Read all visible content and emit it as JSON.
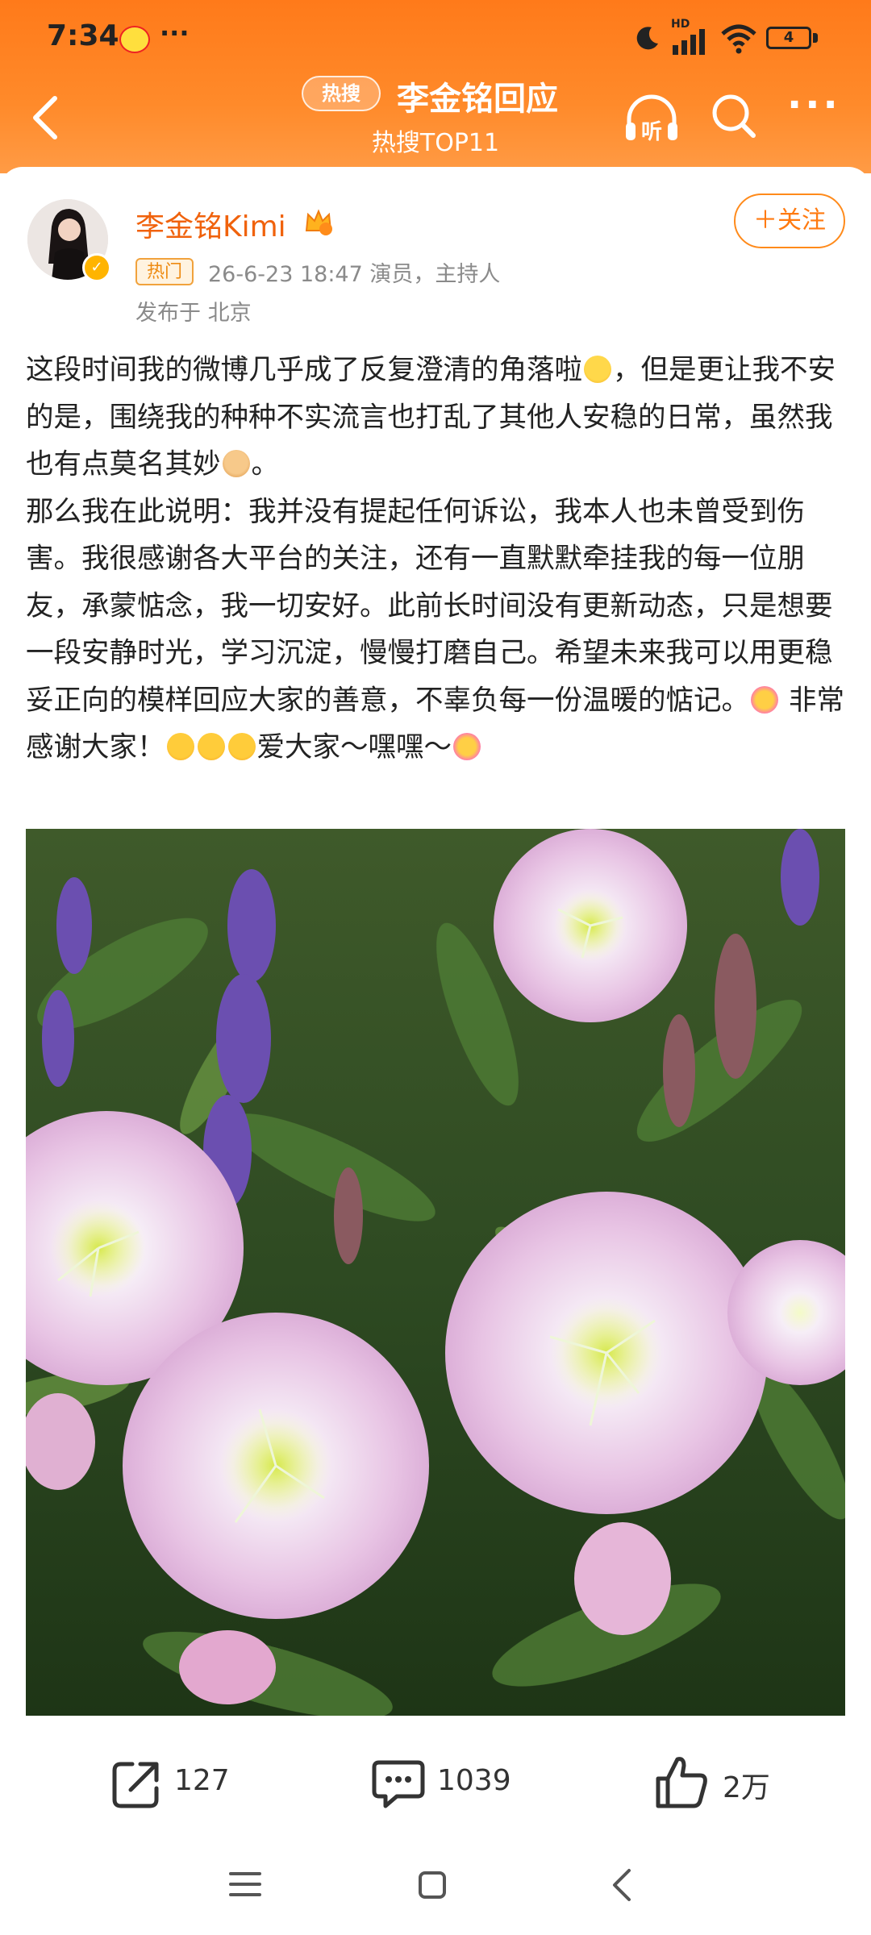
{
  "status_bar": {
    "time": "7:34",
    "more": "···",
    "network": "HD",
    "battery": "4"
  },
  "nav": {
    "hot_search_badge": "热搜",
    "title": "李金铭回应",
    "subtitle": "热搜TOP11",
    "listen_label": "听",
    "more": "···"
  },
  "post": {
    "author": "李金铭Kimi",
    "hot_tag": "热门",
    "meta": "26-6-23 18:47  演员，主持人",
    "location": "发布于 北京",
    "follow_label": "＋关注",
    "paragraph1_a": "这段时间我的微博几乎成了反复澄清的角落啦",
    "paragraph1_b": "，但是更让我不安的是，围绕我的种种不实流言也打乱了其他人安稳的日常，虽然我也有点莫名其妙",
    "paragraph1_c": "。",
    "paragraph2_a": "那么我在此说明：我并没有提起任何诉讼，我本人也未曾受到伤害。我很感谢各大平台的关注，还有一直默默牵挂我的每一位朋友，承蒙惦念，我一切安好。此前长时间没有更新动态，只是想要一段安静时光，学习沉淀，慢慢打磨自己。希望未来我可以用更稳妥正向的模样回应大家的善意，不辜负每一份温暖的惦记。",
    "paragraph2_b": " 非常感谢大家！",
    "paragraph2_c": "爱大家～嘿嘿～",
    "image_alt": "粉色月见草花丛与紫色鼠尾草"
  },
  "actions": {
    "share_count": "127",
    "comment_count": "1039",
    "like_count": "2万"
  },
  "colors": {
    "header_orange": "#ff7a1a",
    "accent": "#f0620c"
  }
}
